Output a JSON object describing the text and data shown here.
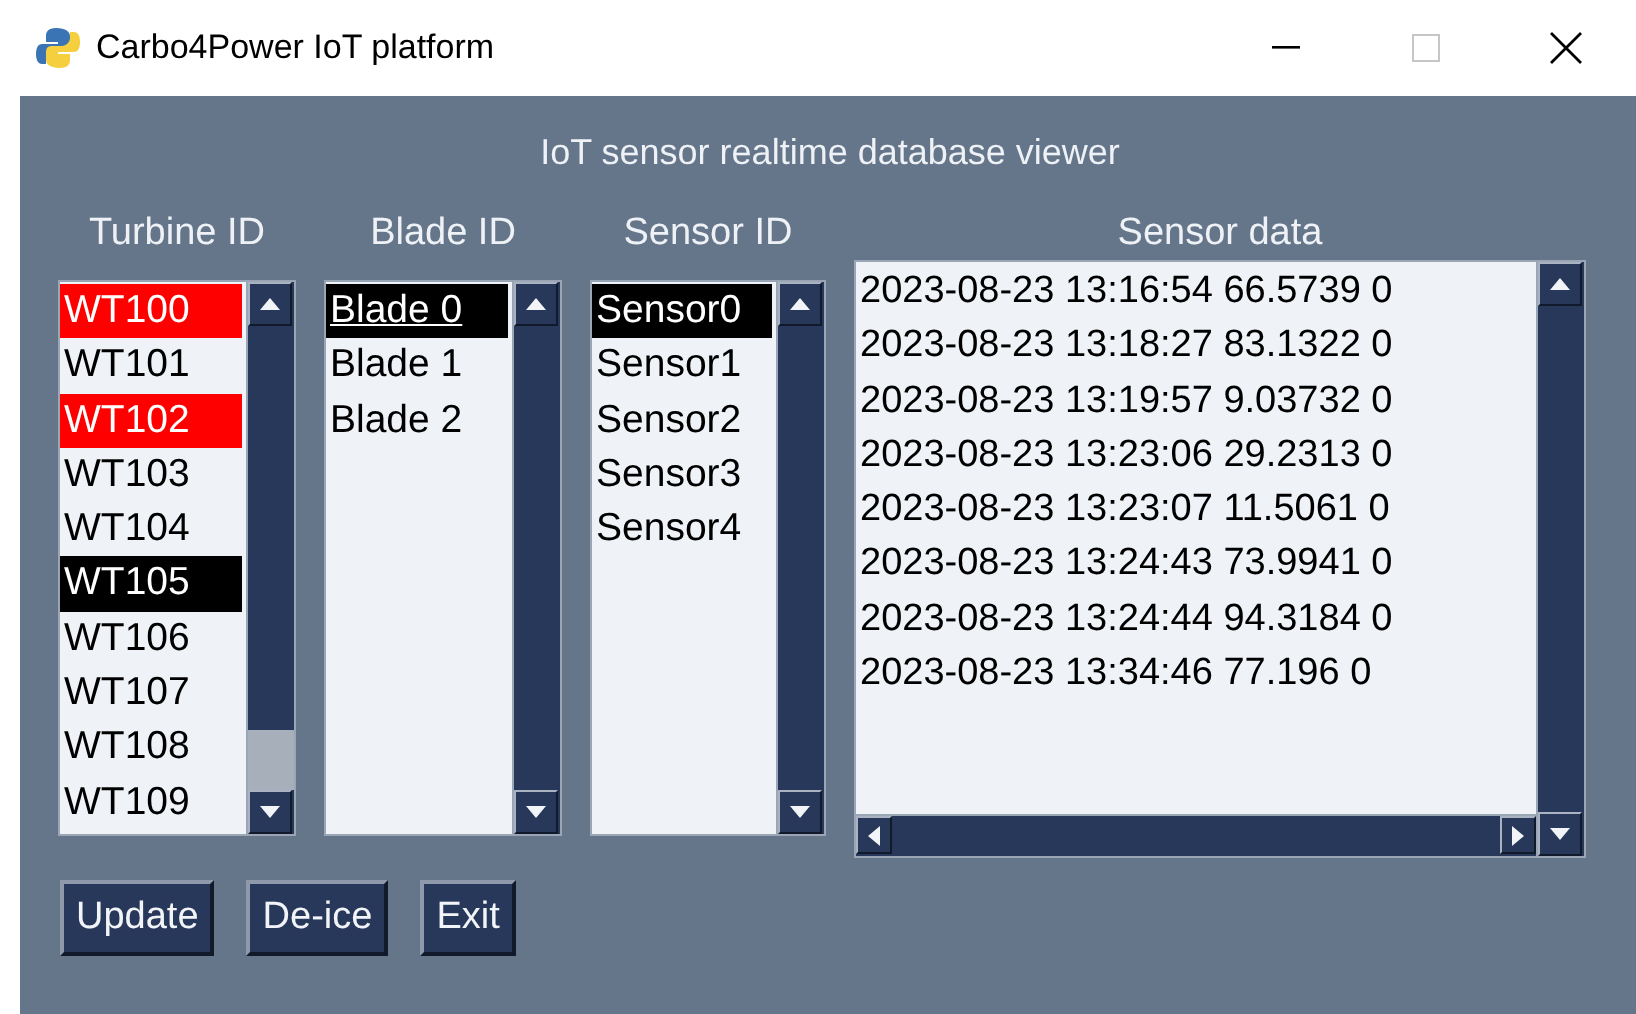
{
  "window": {
    "title": "Carbo4Power IoT platform"
  },
  "heading": "IoT sensor realtime database viewer",
  "lists": [
    {
      "kind": "turbine",
      "header": "Turbine ID",
      "focused": false,
      "items": [
        {
          "label": "WT100",
          "selected": false,
          "alarm": true
        },
        {
          "label": "WT101",
          "selected": false,
          "alarm": false
        },
        {
          "label": "WT102",
          "selected": false,
          "alarm": true
        },
        {
          "label": "WT103",
          "selected": false,
          "alarm": false
        },
        {
          "label": "WT104",
          "selected": false,
          "alarm": false
        },
        {
          "label": "WT105",
          "selected": true,
          "alarm": false
        },
        {
          "label": "WT106",
          "selected": false,
          "alarm": false
        },
        {
          "label": "WT107",
          "selected": false,
          "alarm": false
        },
        {
          "label": "WT108",
          "selected": false,
          "alarm": false
        },
        {
          "label": "WT109",
          "selected": false,
          "alarm": false
        }
      ]
    },
    {
      "kind": "blade",
      "header": "Blade ID",
      "focused": true,
      "items": [
        {
          "label": "Blade 0",
          "selected": true,
          "alarm": false
        },
        {
          "label": "Blade 1",
          "selected": false,
          "alarm": false
        },
        {
          "label": "Blade 2",
          "selected": false,
          "alarm": false
        }
      ]
    },
    {
      "kind": "sensor",
      "header": "Sensor ID",
      "focused": false,
      "items": [
        {
          "label": "Sensor0",
          "selected": true,
          "alarm": false
        },
        {
          "label": "Sensor1",
          "selected": false,
          "alarm": false
        },
        {
          "label": "Sensor2",
          "selected": false,
          "alarm": false
        },
        {
          "label": "Sensor3",
          "selected": false,
          "alarm": false
        },
        {
          "label": "Sensor4",
          "selected": false,
          "alarm": false
        }
      ]
    }
  ],
  "sensor_data": {
    "header": "Sensor data",
    "rows": [
      "2023-08-23 13:16:54 66.5739 0",
      "2023-08-23 13:18:27 83.1322 0",
      "2023-08-23 13:19:57 9.03732 0",
      "2023-08-23 13:23:06 29.2313 0",
      "2023-08-23 13:23:07 11.5061 0",
      "2023-08-23 13:24:43 73.9941 0",
      "2023-08-23 13:24:44 94.3184 0",
      "2023-08-23 13:34:46 77.196 0"
    ]
  },
  "buttons": [
    "Update",
    "De-ice",
    "Exit"
  ]
}
